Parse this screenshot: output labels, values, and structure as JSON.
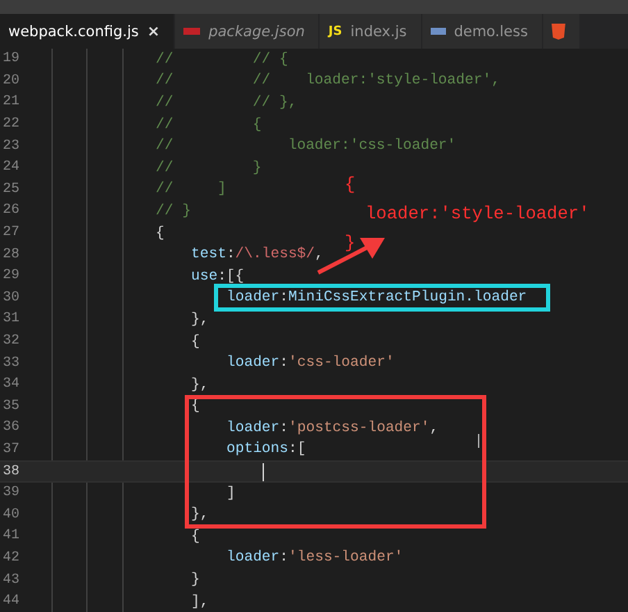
{
  "tabs": [
    {
      "label": "webpack.config.js",
      "selected": true,
      "preview": false,
      "kind": "plain",
      "close": "×"
    },
    {
      "label": "package.json",
      "selected": false,
      "preview": true,
      "kind": "npm"
    },
    {
      "label": "index.js",
      "selected": false,
      "preview": false,
      "kind": "js",
      "badge": "JS"
    },
    {
      "label": "demo.less",
      "selected": false,
      "preview": false,
      "kind": "less"
    },
    {
      "selected": false,
      "kind": "html"
    }
  ],
  "editor": {
    "lines": [
      {
        "number": "19",
        "tokens": [
          {
            "kind": "comment",
            "text": "//         // {"
          }
        ]
      },
      {
        "number": "20",
        "tokens": [
          {
            "kind": "comment",
            "text": "//         //    loader:'style-loader',"
          }
        ]
      },
      {
        "number": "21",
        "tokens": [
          {
            "kind": "comment",
            "text": "//         // },"
          }
        ]
      },
      {
        "number": "22",
        "tokens": [
          {
            "kind": "comment",
            "text": "//         {"
          }
        ]
      },
      {
        "number": "23",
        "tokens": [
          {
            "kind": "comment",
            "text": "//             loader:'css-loader'"
          }
        ]
      },
      {
        "number": "24",
        "tokens": [
          {
            "kind": "comment",
            "text": "//         }"
          }
        ]
      },
      {
        "number": "25",
        "tokens": [
          {
            "kind": "comment",
            "text": "//     ]"
          }
        ]
      },
      {
        "number": "26",
        "tokens": [
          {
            "kind": "comment",
            "text": "// }"
          }
        ]
      },
      {
        "number": "27",
        "tokens": [
          {
            "kind": "punct",
            "text": "{"
          }
        ],
        "children": [
          {
            "number": "28",
            "tokens": [
              {
                "kind": "key",
                "text": "test"
              },
              {
                "kind": "punct",
                "text": ":"
              },
              {
                "kind": "regex",
                "text": "/\\.less$/"
              },
              {
                "kind": "punct",
                "text": ","
              }
            ]
          },
          {
            "number": "29",
            "tokens": [
              {
                "kind": "key",
                "text": "use"
              },
              {
                "kind": "punct",
                "text": ":[{"
              }
            ],
            "children": [
              {
                "number": "30",
                "tokens": [
                  {
                    "kind": "key",
                    "text": "loader"
                  },
                  {
                    "kind": "punct",
                    "text": ":"
                  },
                  {
                    "kind": "key",
                    "text": "MiniCssExtractPlugin.loader"
                  }
                ]
              }
            ]
          },
          {
            "number": "31",
            "tokens": [
              {
                "kind": "punct",
                "text": "},"
              }
            ]
          },
          {
            "number": "32",
            "tokens": [
              {
                "kind": "punct",
                "text": "{"
              }
            ],
            "children": [
              {
                "number": "33",
                "tokens": [
                  {
                    "kind": "key",
                    "text": "loader"
                  },
                  {
                    "kind": "punct",
                    "text": ":"
                  },
                  {
                    "kind": "string",
                    "text": "'css-loader'"
                  }
                ]
              }
            ]
          },
          {
            "number": "34",
            "tokens": [
              {
                "kind": "punct",
                "text": "},"
              }
            ]
          },
          {
            "number": "35",
            "tokens": [
              {
                "kind": "punct",
                "text": "{"
              }
            ],
            "children": [
              {
                "number": "36",
                "tokens": [
                  {
                    "kind": "key",
                    "text": "loader"
                  },
                  {
                    "kind": "punct",
                    "text": ":"
                  },
                  {
                    "kind": "string",
                    "text": "'postcss-loader'"
                  },
                  {
                    "kind": "punct",
                    "text": ","
                  }
                ]
              },
              {
                "number": "37",
                "tokens": [
                  {
                    "kind": "key",
                    "text": "options"
                  },
                  {
                    "kind": "punct",
                    "text": ":["
                  }
                ],
                "children": [
                  {
                    "number": "38",
                    "current": true,
                    "tokens": [
                      {
                        "kind": "caret"
                      }
                    ]
                  }
                ]
              },
              {
                "number": "39",
                "tokens": [
                  {
                    "kind": "punct",
                    "text": "]"
                  }
                ]
              }
            ]
          },
          {
            "number": "40",
            "tokens": [
              {
                "kind": "punct",
                "text": "},"
              }
            ]
          },
          {
            "number": "41",
            "tokens": [
              {
                "kind": "punct",
                "text": "{"
              }
            ],
            "children": [
              {
                "number": "42",
                "tokens": [
                  {
                    "kind": "key",
                    "text": "loader"
                  },
                  {
                    "kind": "punct",
                    "text": ":"
                  },
                  {
                    "kind": "string",
                    "text": "'less-loader'"
                  }
                ]
              }
            ]
          },
          {
            "number": "43",
            "tokens": [
              {
                "kind": "punct",
                "text": "}"
              }
            ]
          },
          {
            "number": "44",
            "tokens": [
              {
                "kind": "punct",
                "text": "],"
              }
            ]
          }
        ]
      }
    ]
  },
  "annotations": [
    {
      "kind": "note",
      "lines": [
        "{",
        "loader:'style-loader'",
        "}"
      ]
    },
    {
      "kind": "arrow"
    },
    {
      "kind": "box",
      "color": "#22d3dc"
    },
    {
      "kind": "box",
      "color": "#f23a3a"
    }
  ]
}
